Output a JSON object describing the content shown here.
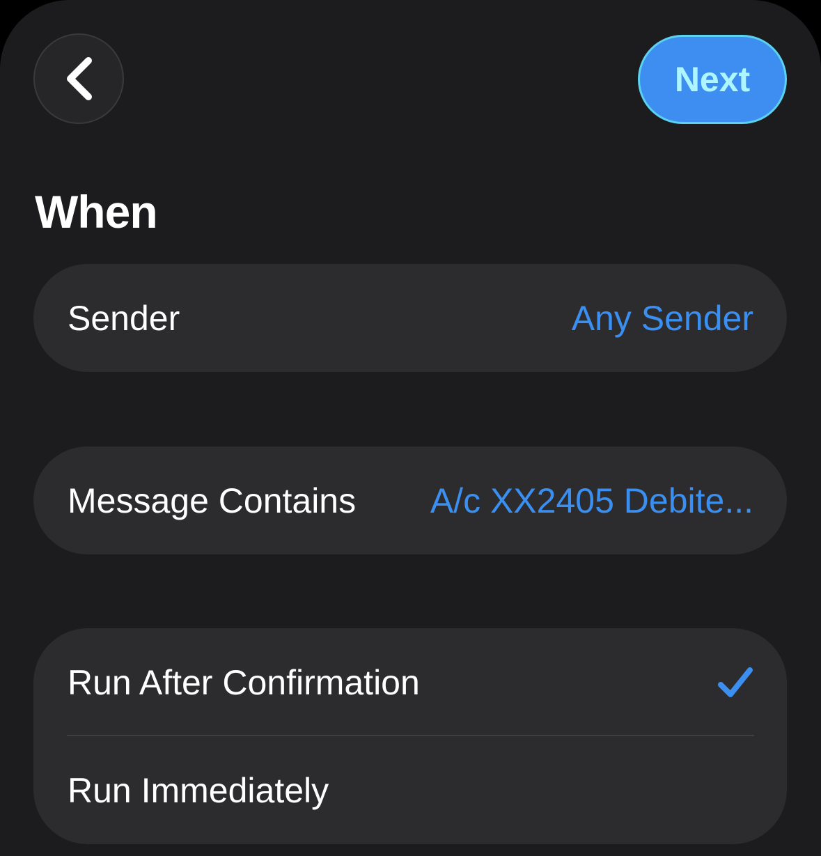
{
  "header": {
    "back_icon": "chevron-left-icon",
    "next_label": "Next"
  },
  "section": {
    "title": "When"
  },
  "sender_row": {
    "label": "Sender",
    "value": "Any Sender"
  },
  "message_row": {
    "label": "Message Contains",
    "value": "A/c XX2405 Debite..."
  },
  "run_options": [
    {
      "label": "Run After Confirmation",
      "selected": true,
      "icon": "checkmark-icon"
    },
    {
      "label": "Run Immediately",
      "selected": false
    }
  ],
  "colors": {
    "background": "#1c1c1e",
    "card": "#2c2c2e",
    "accent": "#3a8ff0",
    "next_button": "#3d8ef0",
    "next_text": "#aef6ff"
  }
}
